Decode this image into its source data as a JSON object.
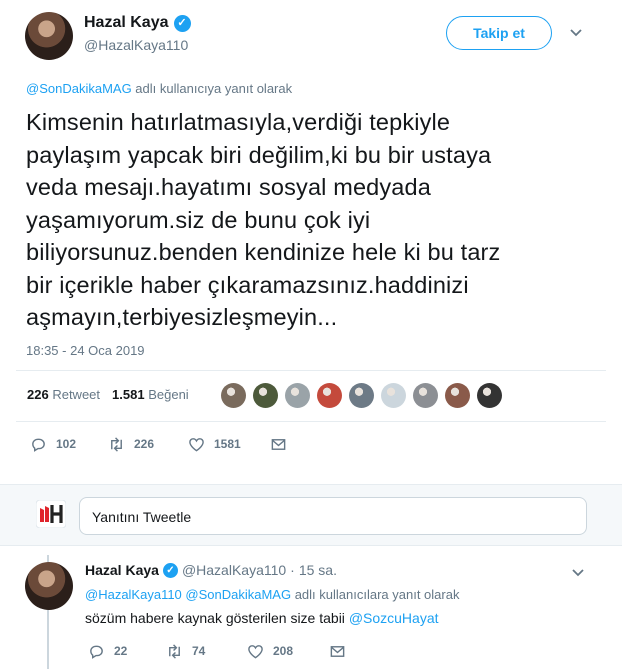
{
  "tweet": {
    "author_name": "Hazal Kaya",
    "author_handle": "@HazalKaya110",
    "follow_label": "Takip et",
    "reply_to_mention": "@SonDakikaMAG",
    "reply_to_suffix": " adlı kullanıcıya yanıt olarak",
    "text": "Kimsenin hatırlatmasıyla,verdiği tepkiyle\npaylaşım yapcak biri değilim,ki bu bir ustaya\nveda mesajı.hayatımı sosyal medyada\nyaşamıyorum.siz de bunu çok iyi\nbiliyorsunuz.benden kendinize hele ki bu tarz\nbir içerikle haber çıkaramazsınız.haddinizi\naşmayın,terbiyesizleşmeyin...",
    "timestamp": "18:35 - 24 Oca 2019",
    "retweet_count": "226",
    "retweet_label": "Retweet",
    "like_count": "1.581",
    "like_label": "Beğeni",
    "actions": {
      "replies": "102",
      "retweets": "226",
      "likes": "1581"
    }
  },
  "likers": [
    {
      "color": "#7a6b5d"
    },
    {
      "color": "#4d5a3b"
    },
    {
      "color": "#9aa3a8"
    },
    {
      "color": "#c44a3c"
    },
    {
      "color": "#6d7a86"
    },
    {
      "color": "#ccd6dd"
    },
    {
      "color": "#8c8f94"
    },
    {
      "color": "#8a5a4a"
    },
    {
      "color": "#333333"
    }
  ],
  "reply_box": {
    "placeholder": "Yanıtını Tweetle"
  },
  "reply": {
    "author_name": "Hazal Kaya",
    "author_handle": "@HazalKaya110",
    "time": "15 sa.",
    "reply_to_mentions": "@HazalKaya110 @SonDakikaMAG",
    "reply_to_suffix": " adlı kullanıcılara yanıt olarak",
    "text": "sözüm habere kaynak gösterilen size tabii ",
    "text_mention": "@SozcuHayat",
    "actions": {
      "replies": "22",
      "retweets": "74",
      "likes": "208"
    }
  },
  "colors": {
    "accent": "#1da1f2",
    "muted": "#657786",
    "text": "#14171a"
  }
}
